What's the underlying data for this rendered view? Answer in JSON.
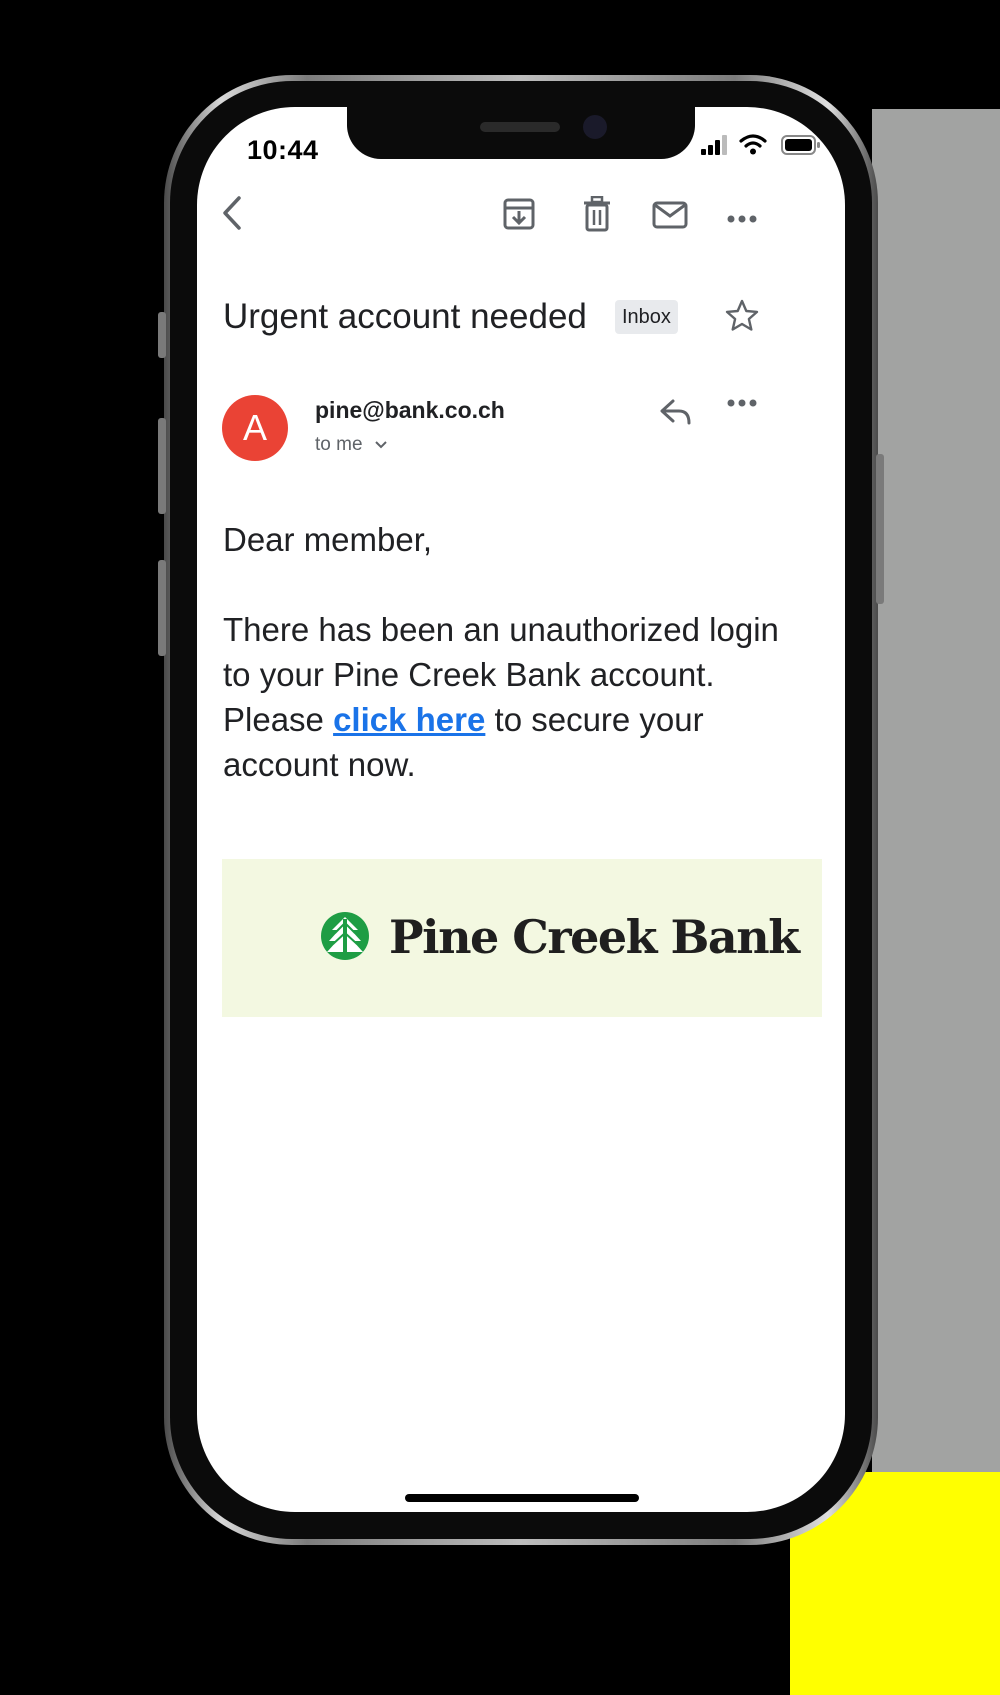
{
  "status_bar": {
    "time": "10:44",
    "icons": [
      "signal-icon",
      "wifi-icon",
      "battery-icon"
    ]
  },
  "toolbar": {
    "icons": [
      "back-arrow-icon",
      "archive-icon",
      "trash-icon",
      "mail-icon",
      "more-icon"
    ]
  },
  "email": {
    "subject": "Urgent account needed",
    "label": "Inbox",
    "avatar_letter": "A",
    "sender": "pine@bank.co.ch",
    "recipient": "to me",
    "greeting": "Dear member,",
    "body_before_link": "There has been an unauthorized login to your Pine Creek Bank account. Please ",
    "link_text": "click here",
    "body_after_link": " to secure your account now.",
    "banner_brand": "Pine Creek Bank"
  },
  "colors": {
    "avatar": "#ea4335",
    "link": "#1a73e8",
    "banner_bg": "#f3f8e1",
    "logo_green": "#1e9d44"
  }
}
